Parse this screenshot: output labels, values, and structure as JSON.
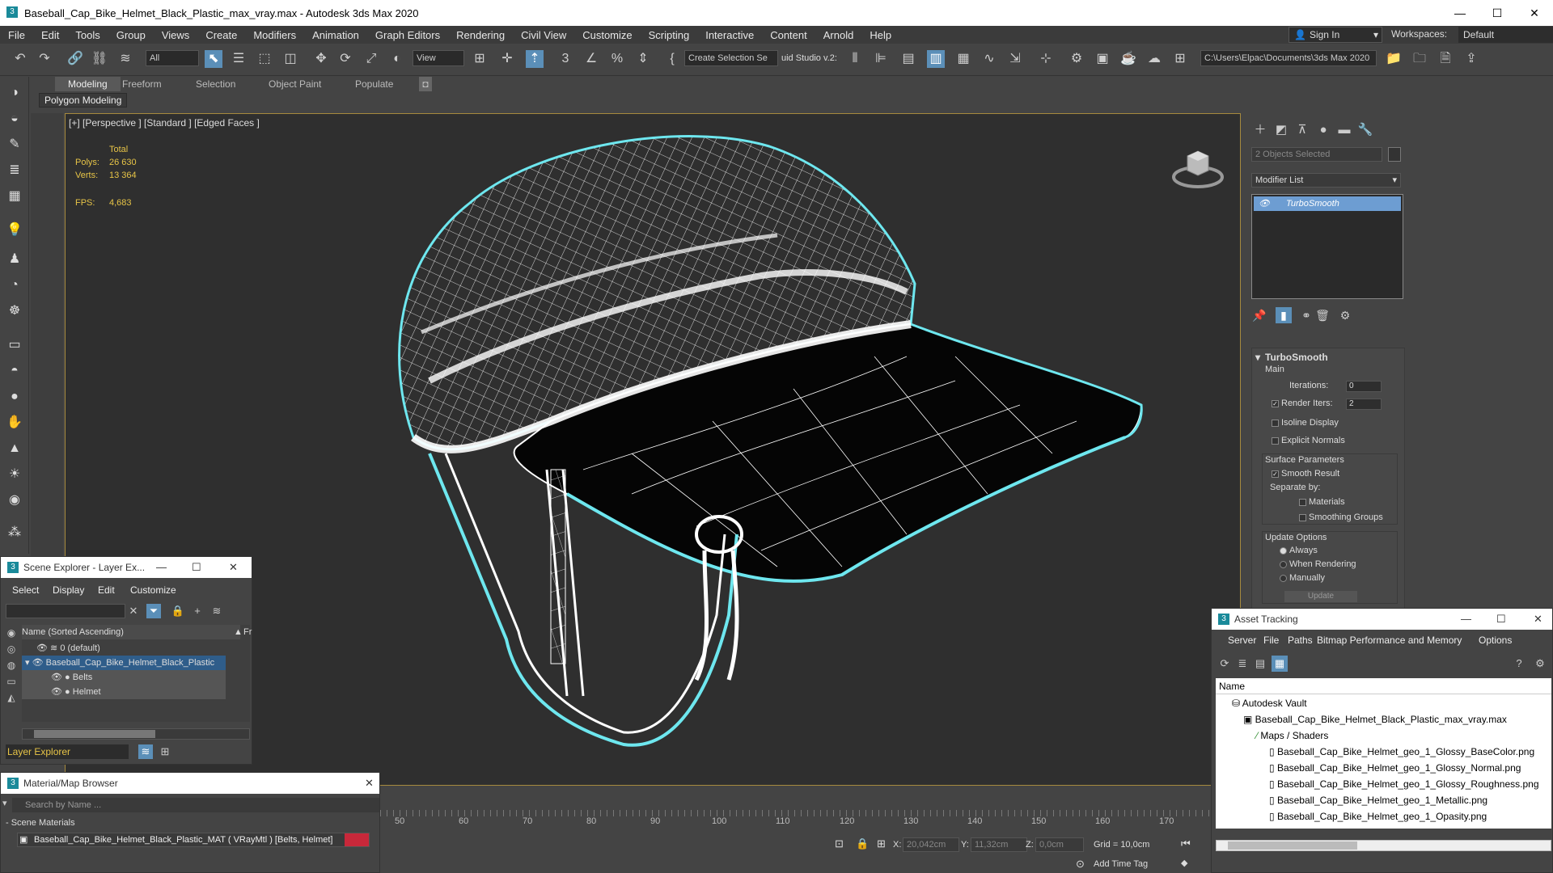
{
  "window": {
    "title": "Baseball_Cap_Bike_Helmet_Black_Plastic_max_vray.max - Autodesk 3ds Max 2020",
    "minimize": "—",
    "maximize": "☐",
    "close": "✕"
  },
  "menu": [
    "File",
    "Edit",
    "Tools",
    "Group",
    "Views",
    "Create",
    "Modifiers",
    "Animation",
    "Graph Editors",
    "Rendering",
    "Civil View",
    "Customize",
    "Scripting",
    "Interactive",
    "Content",
    "Arnold",
    "Help"
  ],
  "account": {
    "signin": "Sign In",
    "workspaces_label": "Workspaces:",
    "workspace": "Default"
  },
  "toolbar": {
    "filter": "All",
    "view": "View",
    "selection_set": "Create Selection Se",
    "studio": "uid Studio v.2:",
    "path": "C:\\Users\\Elpac\\Documents\\3ds Max 2020"
  },
  "ribbon": {
    "tabs": [
      "Modeling",
      "Freeform",
      "Selection",
      "Object Paint",
      "Populate"
    ],
    "panel": "Polygon Modeling"
  },
  "viewport": {
    "label": "[+] [Perspective ] [Standard ] [Edged Faces ]",
    "stats_header": "Total",
    "polys_label": "Polys:",
    "polys": "26 630",
    "verts_label": "Verts:",
    "verts": "13 364",
    "fps_label": "FPS:",
    "fps": "4,683"
  },
  "command_panel": {
    "selection": "2 Objects Selected",
    "modifier_list": "Modifier List",
    "stack_item": "TurboSmooth",
    "rollout": {
      "title": "TurboSmooth",
      "main": "Main",
      "iterations_label": "Iterations:",
      "iterations": "0",
      "render_iters_label": "Render Iters:",
      "render_iters": "2",
      "isoline": "Isoline Display",
      "explicit": "Explicit Normals",
      "surface": "Surface Parameters",
      "smooth_result": "Smooth Result",
      "separate": "Separate by:",
      "materials": "Materials",
      "smoothing_groups": "Smoothing Groups",
      "update_options": "Update Options",
      "always": "Always",
      "when_rendering": "When Rendering",
      "manually": "Manually",
      "update_btn": "Update"
    }
  },
  "scene_explorer": {
    "title": "Scene Explorer - Layer Ex...",
    "menu": [
      "Select",
      "Display",
      "Edit",
      "Customize"
    ],
    "column": "Name (Sorted Ascending)",
    "column_right": "Fr",
    "rows": [
      "0 (default)",
      "Baseball_Cap_Bike_Helmet_Black_Plastic",
      "Belts",
      "Helmet"
    ],
    "layer_explorer": "Layer Explorer"
  },
  "material_browser": {
    "title": "Material/Map Browser",
    "search": "Search by Name ...",
    "group": "- Scene Materials",
    "item": "Baseball_Cap_Bike_Helmet_Black_Plastic_MAT ( VRayMtl ) [Belts, Helmet]"
  },
  "timeline": {
    "ticks": [
      "50",
      "60",
      "70",
      "80",
      "90",
      "100",
      "110",
      "120",
      "130",
      "140",
      "150",
      "160",
      "170"
    ]
  },
  "status": {
    "x_label": "X:",
    "x": "20,042cm",
    "y_label": "Y:",
    "y": "11,32cm",
    "z_label": "Z:",
    "z": "0,0cm",
    "grid": "Grid = 10,0cm",
    "add_time_tag": "Add Time Tag"
  },
  "asset_tracking": {
    "title": "Asset Tracking",
    "menu": [
      "Server",
      "File",
      "Paths",
      "Bitmap Performance and Memory",
      "Options"
    ],
    "column": "Name",
    "rows": [
      "Autodesk Vault",
      "Baseball_Cap_Bike_Helmet_Black_Plastic_max_vray.max",
      "Maps / Shaders",
      "Baseball_Cap_Bike_Helmet_geo_1_Glossy_BaseColor.png",
      "Baseball_Cap_Bike_Helmet_geo_1_Glossy_Normal.png",
      "Baseball_Cap_Bike_Helmet_geo_1_Glossy_Roughness.png",
      "Baseball_Cap_Bike_Helmet_geo_1_Metallic.png",
      "Baseball_Cap_Bike_Helmet_geo_1_Opasity.png"
    ]
  }
}
